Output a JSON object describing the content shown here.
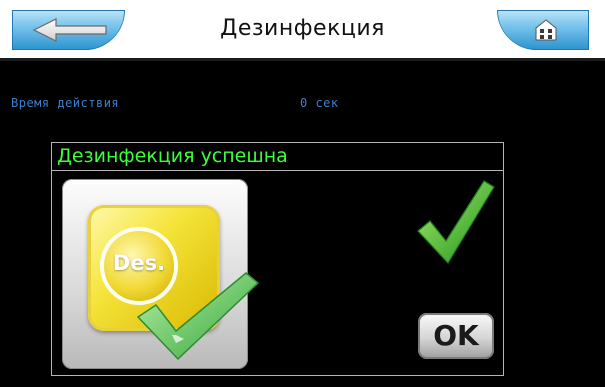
{
  "header": {
    "title": "Дезинфекция",
    "back_icon": "arrow-left-icon",
    "home_icon": "home-icon",
    "accent_color": "#2b93cf"
  },
  "info": {
    "time_label": "Время действия",
    "time_value": "0 сек"
  },
  "dialog": {
    "title": "Дезинфекция успешна",
    "title_color": "#3cff3c",
    "tile_label": "Des.",
    "success_icon": "checkmark-icon",
    "ok_label": "OK"
  }
}
